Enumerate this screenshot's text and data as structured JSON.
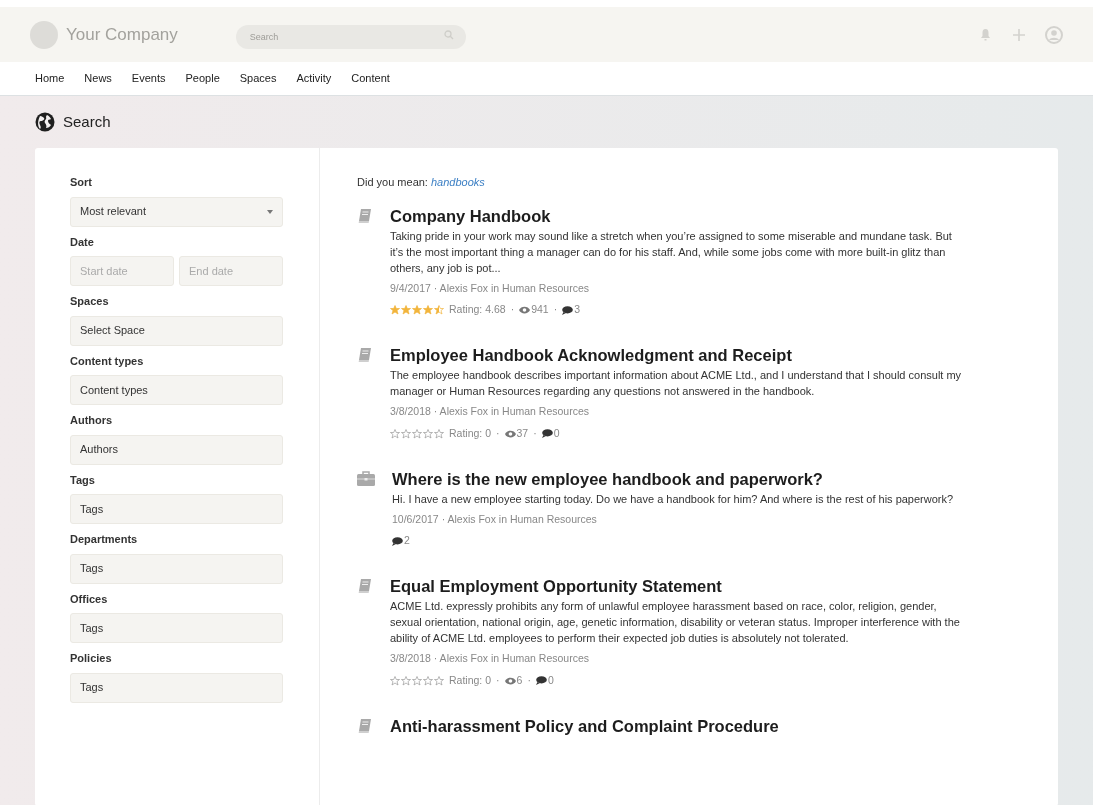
{
  "header": {
    "brand": "Your Company",
    "search": {
      "placeholder": "Search"
    }
  },
  "nav": [
    "Home",
    "News",
    "Events",
    "People",
    "Spaces",
    "Activity",
    "Content"
  ],
  "page_title": "Search",
  "filters": [
    {
      "kind": "select",
      "label": "Sort",
      "value": "Most relevant"
    },
    {
      "kind": "daterange",
      "label": "Date",
      "start_placeholder": "Start date",
      "end_placeholder": "End date"
    },
    {
      "kind": "field",
      "label": "Spaces",
      "value": "Select Space"
    },
    {
      "kind": "field",
      "label": "Content types",
      "value": "Content types"
    },
    {
      "kind": "field",
      "label": "Authors",
      "value": "Authors"
    },
    {
      "kind": "field",
      "label": "Tags",
      "value": "Tags"
    },
    {
      "kind": "field",
      "label": "Departments",
      "value": "Tags"
    },
    {
      "kind": "field",
      "label": "Offices",
      "value": "Tags"
    },
    {
      "kind": "field",
      "label": "Policies",
      "value": "Tags"
    }
  ],
  "suggestion": {
    "prefix": "Did you mean:",
    "term": "handbooks"
  },
  "results": [
    {
      "kind": "document",
      "title": "Company Handbook",
      "excerpt": "Taking pride in your work may sound like a stretch when you’re assigned to some miserable and mundane task. But it’s the most important thing a manager can do for his staff. And, while some jobs come with more built-in glitz than others, any job is pot...",
      "meta": "9/4/2017 · Alexis Fox in Human Resources",
      "stars": 4.5,
      "rating": "Rating: 4.68",
      "separator": "·",
      "views": "941",
      "comments": "3"
    },
    {
      "kind": "document",
      "title": "Employee Handbook Acknowledgment and Receipt",
      "excerpt": "The employee handbook describes important information about ACME Ltd., and I understand that I should consult my manager or Human Resources regarding any questions not answered in the handbook.",
      "meta": "3/8/2018 · Alexis Fox in Human Resources",
      "stars": 0,
      "rating": "Rating: 0",
      "separator": "·",
      "views": "37",
      "comments": "0"
    },
    {
      "kind": "question",
      "title": "Where is the new employee handbook and paperwork?",
      "excerpt": "Hi. I have a new employee starting today. Do we have a handbook for him? And where is the rest of his paperwork?",
      "meta": "10/6/2017 · Alexis Fox in Human Resources",
      "comments": "2"
    },
    {
      "kind": "document",
      "title": "Equal Employment Opportunity Statement",
      "excerpt": "ACME Ltd. expressly prohibits any form of unlawful employee harassment based on race, color, religion, gender, sexual orientation, national origin, age, genetic information, disability or veteran status. Improper interference with the ability of ACME Ltd. employees to perform their expected job duties is absolutely not tolerated.",
      "meta": "3/8/2018 · Alexis Fox in Human Resources",
      "stars": 0,
      "rating": "Rating: 0",
      "separator": "·",
      "views": "6",
      "comments": "0"
    },
    {
      "kind": "document",
      "title": "Anti-harassment Policy and Complaint Procedure"
    }
  ]
}
